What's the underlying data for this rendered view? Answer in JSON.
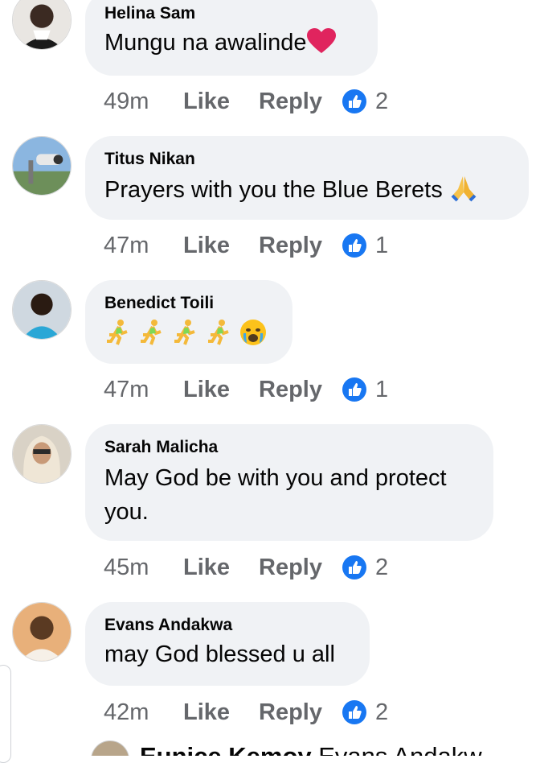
{
  "comments": [
    {
      "author": "Helina Sam",
      "text": "Mungu na awalinde",
      "time": "49m",
      "like": "Like",
      "reply": "Reply",
      "reactions": "2"
    },
    {
      "author": "Titus Nikan",
      "text": "Prayers with you the Blue Berets",
      "time": "47m",
      "like": "Like",
      "reply": "Reply",
      "reactions": "1"
    },
    {
      "author": "Benedict Toili",
      "text": "",
      "time": "47m",
      "like": "Like",
      "reply": "Reply",
      "reactions": "1"
    },
    {
      "author": "Sarah Malicha",
      "text": "May God be with you and protect you.",
      "time": "45m",
      "like": "Like",
      "reply": "Reply",
      "reactions": "2"
    },
    {
      "author": "Evans Andakwa",
      "text": "may God blessed u all",
      "time": "42m",
      "like": "Like",
      "reply": "Reply",
      "reactions": "2"
    }
  ],
  "next_reply": {
    "author": "Eunice Kemoy",
    "mention": "Evans Andakw"
  },
  "icons": {
    "like_reaction": "like-reaction-icon",
    "heart": "red-heart-icon",
    "pray": "folded-hands-icon",
    "runner": "running-man-icon",
    "cry": "crying-face-icon"
  },
  "colors": {
    "bubble": "#f0f2f5",
    "meta": "#65676b",
    "like_blue": "#1877f2",
    "heart": "#e0245e"
  }
}
